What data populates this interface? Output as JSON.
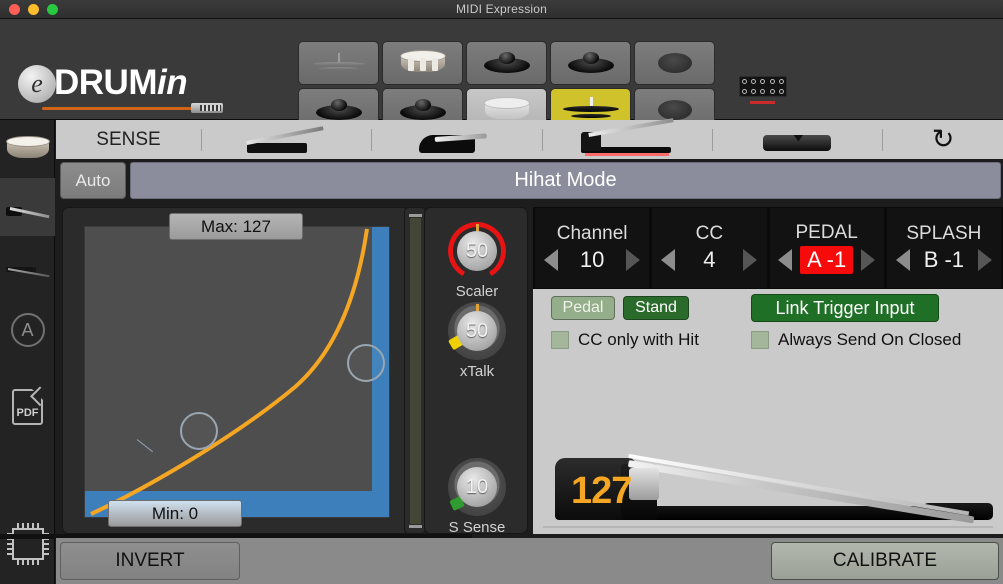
{
  "window": {
    "title": "MIDI Expression"
  },
  "header": {
    "logo": {
      "mark": "e",
      "text_main": "DRUM",
      "text_italic": "in"
    },
    "pads": [
      {
        "name": "ride-cymbal-pad",
        "icon": "ride-cymbal-icon",
        "selected": false
      },
      {
        "name": "snare-pad",
        "icon": "snare-drum-icon",
        "selected": false
      },
      {
        "name": "tom-pad-1",
        "icon": "cymbal-dome-icon",
        "selected": false
      },
      {
        "name": "tom-pad-2",
        "icon": "cymbal-dome-icon",
        "selected": false
      },
      {
        "name": "blank-pad-1",
        "icon": "blank-pad-icon",
        "selected": false
      },
      {
        "name": "tom-pad-3",
        "icon": "cymbal-dome-icon",
        "selected": false
      },
      {
        "name": "tom-pad-4",
        "icon": "cymbal-dome-icon",
        "selected": false
      },
      {
        "name": "light-snare-pad",
        "icon": "snare-drum-icon",
        "selected": false
      },
      {
        "name": "hihat-pad",
        "icon": "hihat-cymbal-icon",
        "selected": true
      },
      {
        "name": "blank-pad-2",
        "icon": "blank-pad-icon",
        "selected": false
      }
    ],
    "connector": {
      "name": "connector-pins",
      "rows": 2,
      "cols": 5,
      "indicator_color": "#cc2b2b"
    }
  },
  "sidebar": {
    "items": [
      {
        "name": "sidebar-item-snare",
        "icon": "snare-drum-icon",
        "active": false
      },
      {
        "name": "sidebar-item-pedal",
        "icon": "pedal-icon",
        "active": true
      },
      {
        "name": "sidebar-item-trigger",
        "icon": "trigger-line-icon",
        "active": false
      },
      {
        "name": "sidebar-item-auto",
        "icon": "circle-a-icon",
        "active": false
      },
      {
        "name": "sidebar-item-pdf",
        "icon": "pdf-icon",
        "active": false,
        "label": "PDF"
      },
      {
        "name": "sidebar-item-firmware",
        "icon": "chip-icon",
        "active": false
      }
    ]
  },
  "sense_bar": {
    "label": "SENSE",
    "pedals": [
      {
        "name": "pedal-type-1",
        "icon": "pedal-flat-icon",
        "selected": false
      },
      {
        "name": "pedal-type-2",
        "icon": "pedal-block-icon",
        "selected": false
      },
      {
        "name": "pedal-type-3",
        "icon": "pedal-hihat-icon",
        "selected": true
      },
      {
        "name": "pedal-type-4",
        "icon": "pedal-slab-icon",
        "selected": false
      }
    ],
    "refresh_icon": "refresh-icon",
    "selected_underline_color": "#ff6b6b"
  },
  "mode_row": {
    "auto_label": "Auto",
    "mode_label": "Hihat Mode"
  },
  "graph": {
    "max_label": "Max: 127",
    "min_label": "Min: 0",
    "curve_color": "#f5a623",
    "fill_color": "#3c7fba",
    "plot_bg": "#4e4e4e"
  },
  "knobs": [
    {
      "name": "scaler-knob",
      "value": "50",
      "label": "Scaler",
      "ring": "red"
    },
    {
      "name": "xtalk-knob",
      "value": "50",
      "label": "xTalk",
      "ring": "plain"
    },
    {
      "name": "s-sense-knob",
      "value": "10",
      "label": "S Sense",
      "ring": "plain"
    }
  ],
  "values": [
    {
      "name": "channel-stepper",
      "caption": "Channel",
      "value": "10",
      "highlight": false
    },
    {
      "name": "cc-stepper",
      "caption": "CC",
      "value": "4",
      "highlight": false
    },
    {
      "name": "pedal-stepper",
      "caption": "PEDAL",
      "value": "A -1",
      "highlight": true
    },
    {
      "name": "splash-stepper",
      "caption": "SPLASH",
      "value": "B -1",
      "highlight": false
    }
  ],
  "controls": {
    "pedal_pill": "Pedal",
    "stand_pill": "Stand",
    "link_button": "Link Trigger Input",
    "checkbox_cc_only": "CC only with Hit",
    "checkbox_always_send": "Always Send On Closed"
  },
  "pedal_preview": {
    "value": "127",
    "value_color": "#f5a623"
  },
  "bottom_bar": {
    "invert": "INVERT",
    "calibrate": "CALIBRATE"
  }
}
